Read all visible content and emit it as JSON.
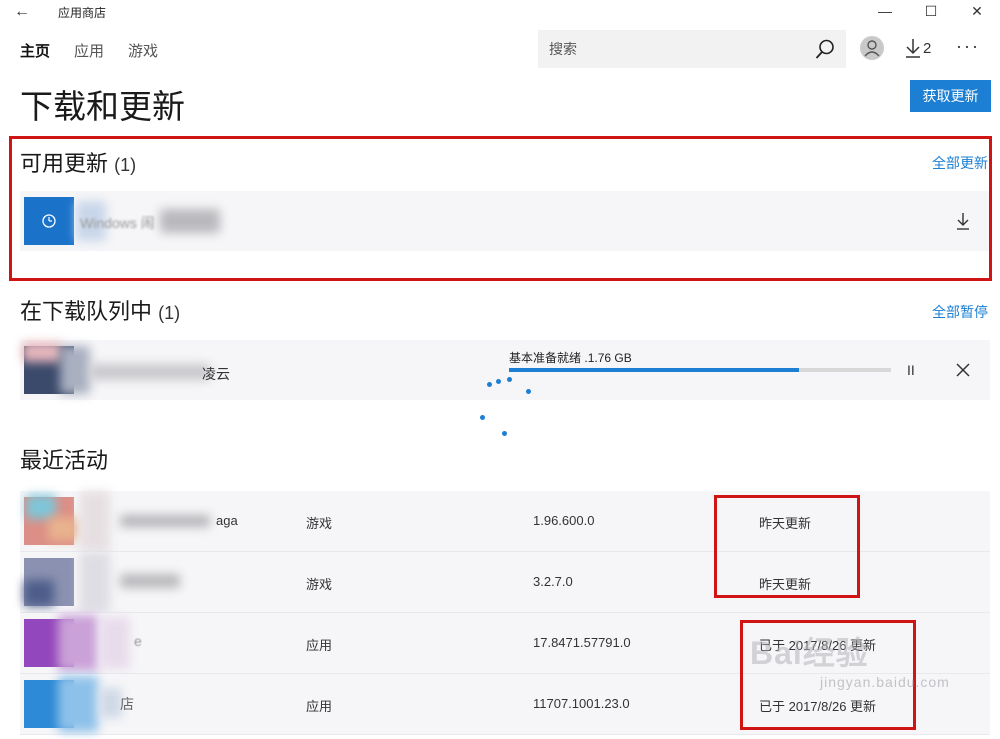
{
  "window": {
    "title": "应用商店",
    "back": "←",
    "minimize": "—",
    "maximize": "☐",
    "close": "✕"
  },
  "nav": {
    "items": [
      "主页",
      "应用",
      "游戏"
    ]
  },
  "search": {
    "placeholder": "搜索"
  },
  "downloads": {
    "count": "2"
  },
  "more": "···",
  "page": {
    "title": "下载和更新",
    "get_updates": "获取更新"
  },
  "available": {
    "title": "可用更新",
    "count": "(1)",
    "link": "全部更新",
    "item": {
      "name": "Windows 闹",
      "accent": "#1a73c9"
    }
  },
  "queue": {
    "title": "在下载队列中",
    "count": "(1)",
    "link": "全部暂停",
    "item": {
      "name": "凌云",
      "status": "基本准备就绪",
      "size": ".1.76 GB",
      "progress": 0.76
    }
  },
  "recent": {
    "title": "最近活动",
    "rows": [
      {
        "name": "aga",
        "type": "游戏",
        "version": "1.96.600.0",
        "status": "昨天更新"
      },
      {
        "name": "",
        "type": "游戏",
        "version": "3.2.7.0",
        "status": "昨天更新"
      },
      {
        "name": "e",
        "type": "应用",
        "version": "17.8471.57791.0",
        "status": "已于 2017/8/26 更新"
      },
      {
        "name": "店",
        "type": "应用",
        "version": "11707.1001.23.0",
        "status": "已于 2017/8/26 更新"
      }
    ]
  },
  "watermark": {
    "main": "Bai经验",
    "sub": "jingyan.baidu.com"
  },
  "colors": {
    "accent": "#1c7fd3",
    "highlight": "#d01313",
    "row_bg": "#f6f6f8"
  }
}
